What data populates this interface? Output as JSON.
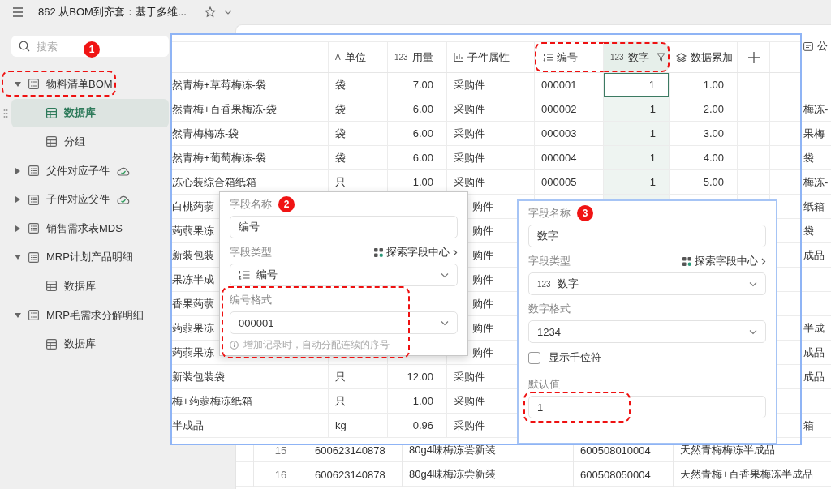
{
  "top_bar": {
    "title": "862 从BOM到齐套：基于多维..."
  },
  "sidebar": {
    "search": {
      "placeholder": "搜索",
      "badge": "1"
    },
    "tree": [
      {
        "label": "物料清单BOM",
        "expanded": true,
        "highlighted": true,
        "synced": false,
        "selected": false,
        "children": [
          {
            "label": "数据库",
            "selected": true
          },
          {
            "label": "分组",
            "selected": false
          }
        ]
      },
      {
        "label": "父件对应子件",
        "expanded": false,
        "highlighted": false,
        "synced": true,
        "selected": false
      },
      {
        "label": "子件对应父件",
        "expanded": false,
        "highlighted": false,
        "synced": true,
        "selected": false
      },
      {
        "label": "销售需求表MDS",
        "expanded": false,
        "highlighted": false,
        "synced": false,
        "selected": false
      },
      {
        "label": "MRP计划产品明细",
        "expanded": true,
        "highlighted": false,
        "synced": false,
        "selected": false,
        "children": [
          {
            "label": "数据库",
            "selected": false
          }
        ]
      },
      {
        "label": "MRP毛需求分解明细",
        "expanded": true,
        "highlighted": false,
        "synced": false,
        "selected": false,
        "children": [
          {
            "label": "数据库",
            "selected": false
          }
        ]
      }
    ]
  },
  "background_table": {
    "column_label": "公",
    "rows": [
      {
        "kind": "empty"
      },
      {
        "kind": "fragment",
        "text": "梅冻-"
      },
      {
        "kind": "fragment",
        "text": "果梅"
      },
      {
        "kind": "fragment",
        "text": "袋"
      },
      {
        "kind": "fragment",
        "text": "梅冻-"
      },
      {
        "kind": "fragment",
        "text": "纸箱"
      },
      {
        "kind": "fragment",
        "text": "袋"
      },
      {
        "kind": "fragment",
        "text": "成品"
      },
      {
        "kind": "empty"
      },
      {
        "kind": "empty"
      },
      {
        "kind": "fragment",
        "text": "半成"
      },
      {
        "kind": "fragment",
        "text": "成品"
      },
      {
        "kind": "fragment",
        "text": "成品"
      },
      {
        "kind": "empty"
      },
      {
        "kind": "fragment",
        "text": "箱"
      },
      {
        "kind": "full",
        "cells": [
          "15",
          "600623140878",
          "80g4味梅冻尝新装",
          "600508010004",
          "天然青梅梅冻半成品"
        ]
      },
      {
        "kind": "full",
        "cells": [
          "16",
          "600623140878",
          "80g4味梅冻尝新装",
          "600508050004",
          "天然青梅+百香果梅冻半成品"
        ]
      }
    ]
  },
  "overlay_table": {
    "columns": [
      {
        "label": "单位",
        "kind": "glyph",
        "glyph": "A",
        "selected": false,
        "highlighted": false,
        "filtered": false
      },
      {
        "label": "用量",
        "kind": "glyph",
        "glyph": "123",
        "selected": false,
        "highlighted": false,
        "filtered": false
      },
      {
        "label": "子件属性",
        "kind": "chart",
        "selected": false,
        "highlighted": false,
        "filtered": false
      },
      {
        "label": "编号",
        "kind": "numbered",
        "selected": false,
        "highlighted": true,
        "filtered": false
      },
      {
        "label": "数字",
        "kind": "glyph",
        "glyph": "123",
        "selected": true,
        "highlighted": true,
        "filtered": true
      },
      {
        "label": "数据累加",
        "kind": "layers",
        "selected": false,
        "highlighted": false,
        "filtered": false
      }
    ],
    "rows": [
      {
        "kind": "full",
        "selected": true,
        "name": "然青梅+草莓梅冻-袋",
        "unit": "袋",
        "qty": "7.00",
        "attr": "采购件",
        "code": "000001",
        "num": "1",
        "acc": "1.00"
      },
      {
        "kind": "full",
        "selected": false,
        "name": "然青梅+百香果梅冻-袋",
        "unit": "袋",
        "qty": "6.00",
        "attr": "采购件",
        "code": "000002",
        "num": "1",
        "acc": "2.00"
      },
      {
        "kind": "full",
        "selected": false,
        "name": "然青梅梅冻-袋",
        "unit": "袋",
        "qty": "6.00",
        "attr": "采购件",
        "code": "000003",
        "num": "1",
        "acc": "3.00"
      },
      {
        "kind": "full",
        "selected": false,
        "name": "然青梅+葡萄梅冻-袋",
        "unit": "袋",
        "qty": "6.00",
        "attr": "采购件",
        "code": "000004",
        "num": "1",
        "acc": "4.00"
      },
      {
        "kind": "full",
        "selected": false,
        "name": "冻心装综合箱纸箱",
        "unit": "只",
        "qty": "1.00",
        "attr": "采购件",
        "code": "000005",
        "num": "1",
        "acc": "5.00"
      },
      {
        "kind": "covered",
        "selected": false,
        "name": "白桃蒟蒻",
        "attr": "购件"
      },
      {
        "kind": "covered",
        "selected": false,
        "name": "蒟蒻果冻",
        "attr": "购件"
      },
      {
        "kind": "covered",
        "selected": false,
        "name": "新装包装",
        "attr": "购件"
      },
      {
        "kind": "covered",
        "selected": false,
        "name": "果冻半成",
        "attr": "购件"
      },
      {
        "kind": "covered",
        "selected": false,
        "name": "香果蒟蒻",
        "attr": "购件"
      },
      {
        "kind": "covered",
        "selected": false,
        "name": "蒟蒻果冻",
        "attr": "购件"
      },
      {
        "kind": "covered",
        "selected": false,
        "name": "蒟蒻果冻",
        "attr": "购件"
      },
      {
        "kind": "full",
        "selected": false,
        "name": "新装包装袋",
        "unit": "只",
        "qty": "12.00",
        "attr": "采购件"
      },
      {
        "kind": "full",
        "selected": false,
        "name": "梅+蒟蒻梅冻纸箱",
        "unit": "只",
        "qty": "1.00",
        "attr": "采购件"
      },
      {
        "kind": "full",
        "selected": false,
        "name": "半成品",
        "unit": "kg",
        "qty": "0.96",
        "attr": "采购件"
      }
    ]
  },
  "field_panels": [
    {
      "badge": "2",
      "sections": [
        {
          "kind": "input",
          "label": "字段名称",
          "value": "编号",
          "highlighted": false
        },
        {
          "kind": "select",
          "label": "字段类型",
          "link": "探索字段中心",
          "option": {
            "kind": "numbered",
            "text": "编号"
          },
          "highlighted": false
        },
        {
          "kind": "select",
          "label": "编号格式",
          "option": {
            "kind": "plain",
            "text": "000001"
          },
          "hint": "增加记录时，自动分配连续的序号",
          "highlighted": true
        }
      ]
    },
    {
      "badge": "3",
      "sections": [
        {
          "kind": "input",
          "label": "字段名称",
          "value": "数字",
          "highlighted": false
        },
        {
          "kind": "select",
          "label": "字段类型",
          "link": "探索字段中心",
          "option": {
            "kind": "glyph",
            "glyph": "123",
            "text": "数字"
          },
          "highlighted": false
        },
        {
          "kind": "select",
          "label": "数字格式",
          "option": {
            "kind": "plain",
            "text": "1234"
          },
          "highlighted": false
        },
        {
          "kind": "checkbox",
          "label": "显示千位符",
          "checked": false
        },
        {
          "kind": "input",
          "label": "默认值",
          "value": "1",
          "highlighted": true
        }
      ]
    }
  ]
}
